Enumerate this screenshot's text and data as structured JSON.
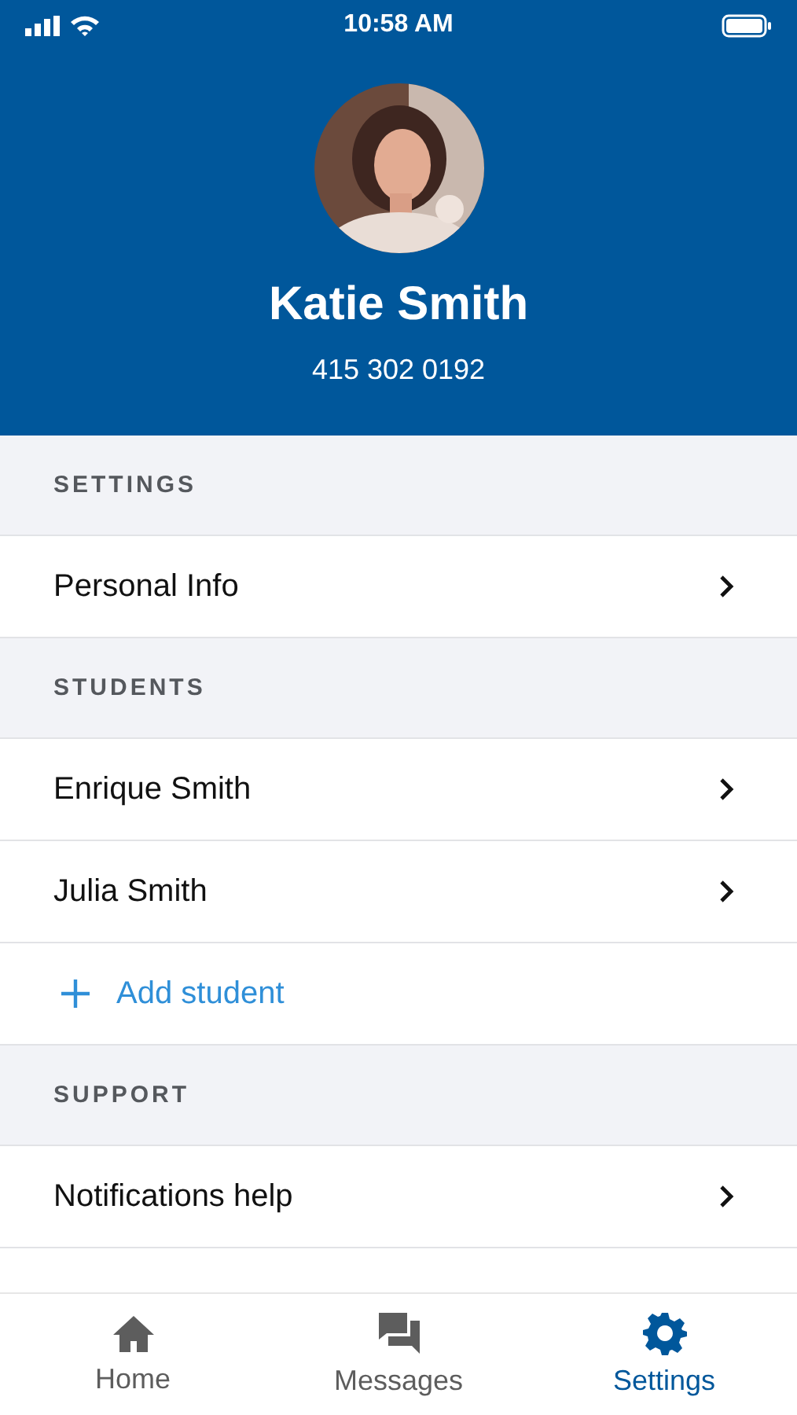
{
  "status_bar": {
    "time": "10:58 AM"
  },
  "profile": {
    "name": "Katie Smith",
    "phone": "415 302 0192"
  },
  "sections": [
    {
      "title": "SETTINGS",
      "items": [
        {
          "kind": "link",
          "label": "Personal Info"
        }
      ]
    },
    {
      "title": "STUDENTS",
      "items": [
        {
          "kind": "link",
          "label": "Enrique Smith"
        },
        {
          "kind": "link",
          "label": "Julia Smith"
        },
        {
          "kind": "add",
          "label": "Add student"
        }
      ]
    },
    {
      "title": "SUPPORT",
      "items": [
        {
          "kind": "link",
          "label": "Notifications help"
        }
      ]
    }
  ],
  "tab_bar": [
    {
      "label": "Home",
      "selected": false
    },
    {
      "label": "Messages",
      "selected": false
    },
    {
      "label": "Settings",
      "selected": true
    }
  ]
}
